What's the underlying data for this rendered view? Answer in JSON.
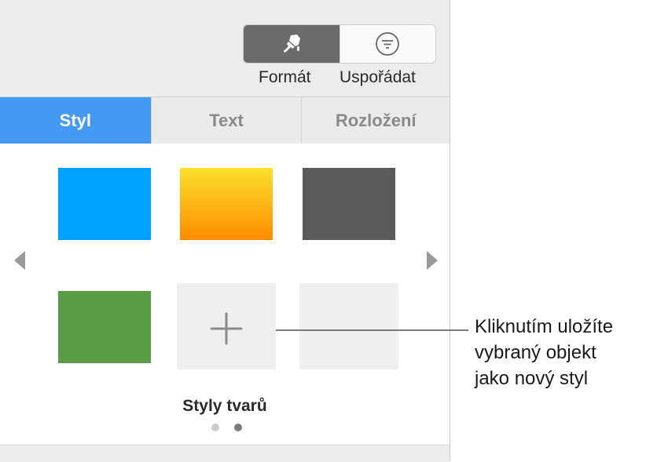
{
  "toolbar": {
    "buttons": [
      {
        "label": "Formát",
        "icon": "paintbrush-icon",
        "active": true
      },
      {
        "label": "Uspořádat",
        "icon": "filter-icon",
        "active": false
      }
    ]
  },
  "tabs": [
    {
      "label": "Styl",
      "active": true
    },
    {
      "label": "Text",
      "active": false
    },
    {
      "label": "Rozložení",
      "active": false
    }
  ],
  "styles": {
    "swatches": [
      {
        "name": "blue",
        "color": "#00a2ff"
      },
      {
        "name": "orange-gradient",
        "color_top": "#fbe02e",
        "color_bottom": "#ff8c00"
      },
      {
        "name": "dark-gray-texture",
        "color": "#5a5a5a"
      },
      {
        "name": "green-texture",
        "color": "#5b9b47"
      }
    ],
    "add_button_icon": "plus-icon",
    "caption": "Styly tvarů",
    "page_count": 2,
    "current_page": 2
  },
  "callout": {
    "lines": [
      "Kliknutím uložíte",
      "vybraný objekt",
      "jako nový styl"
    ]
  }
}
